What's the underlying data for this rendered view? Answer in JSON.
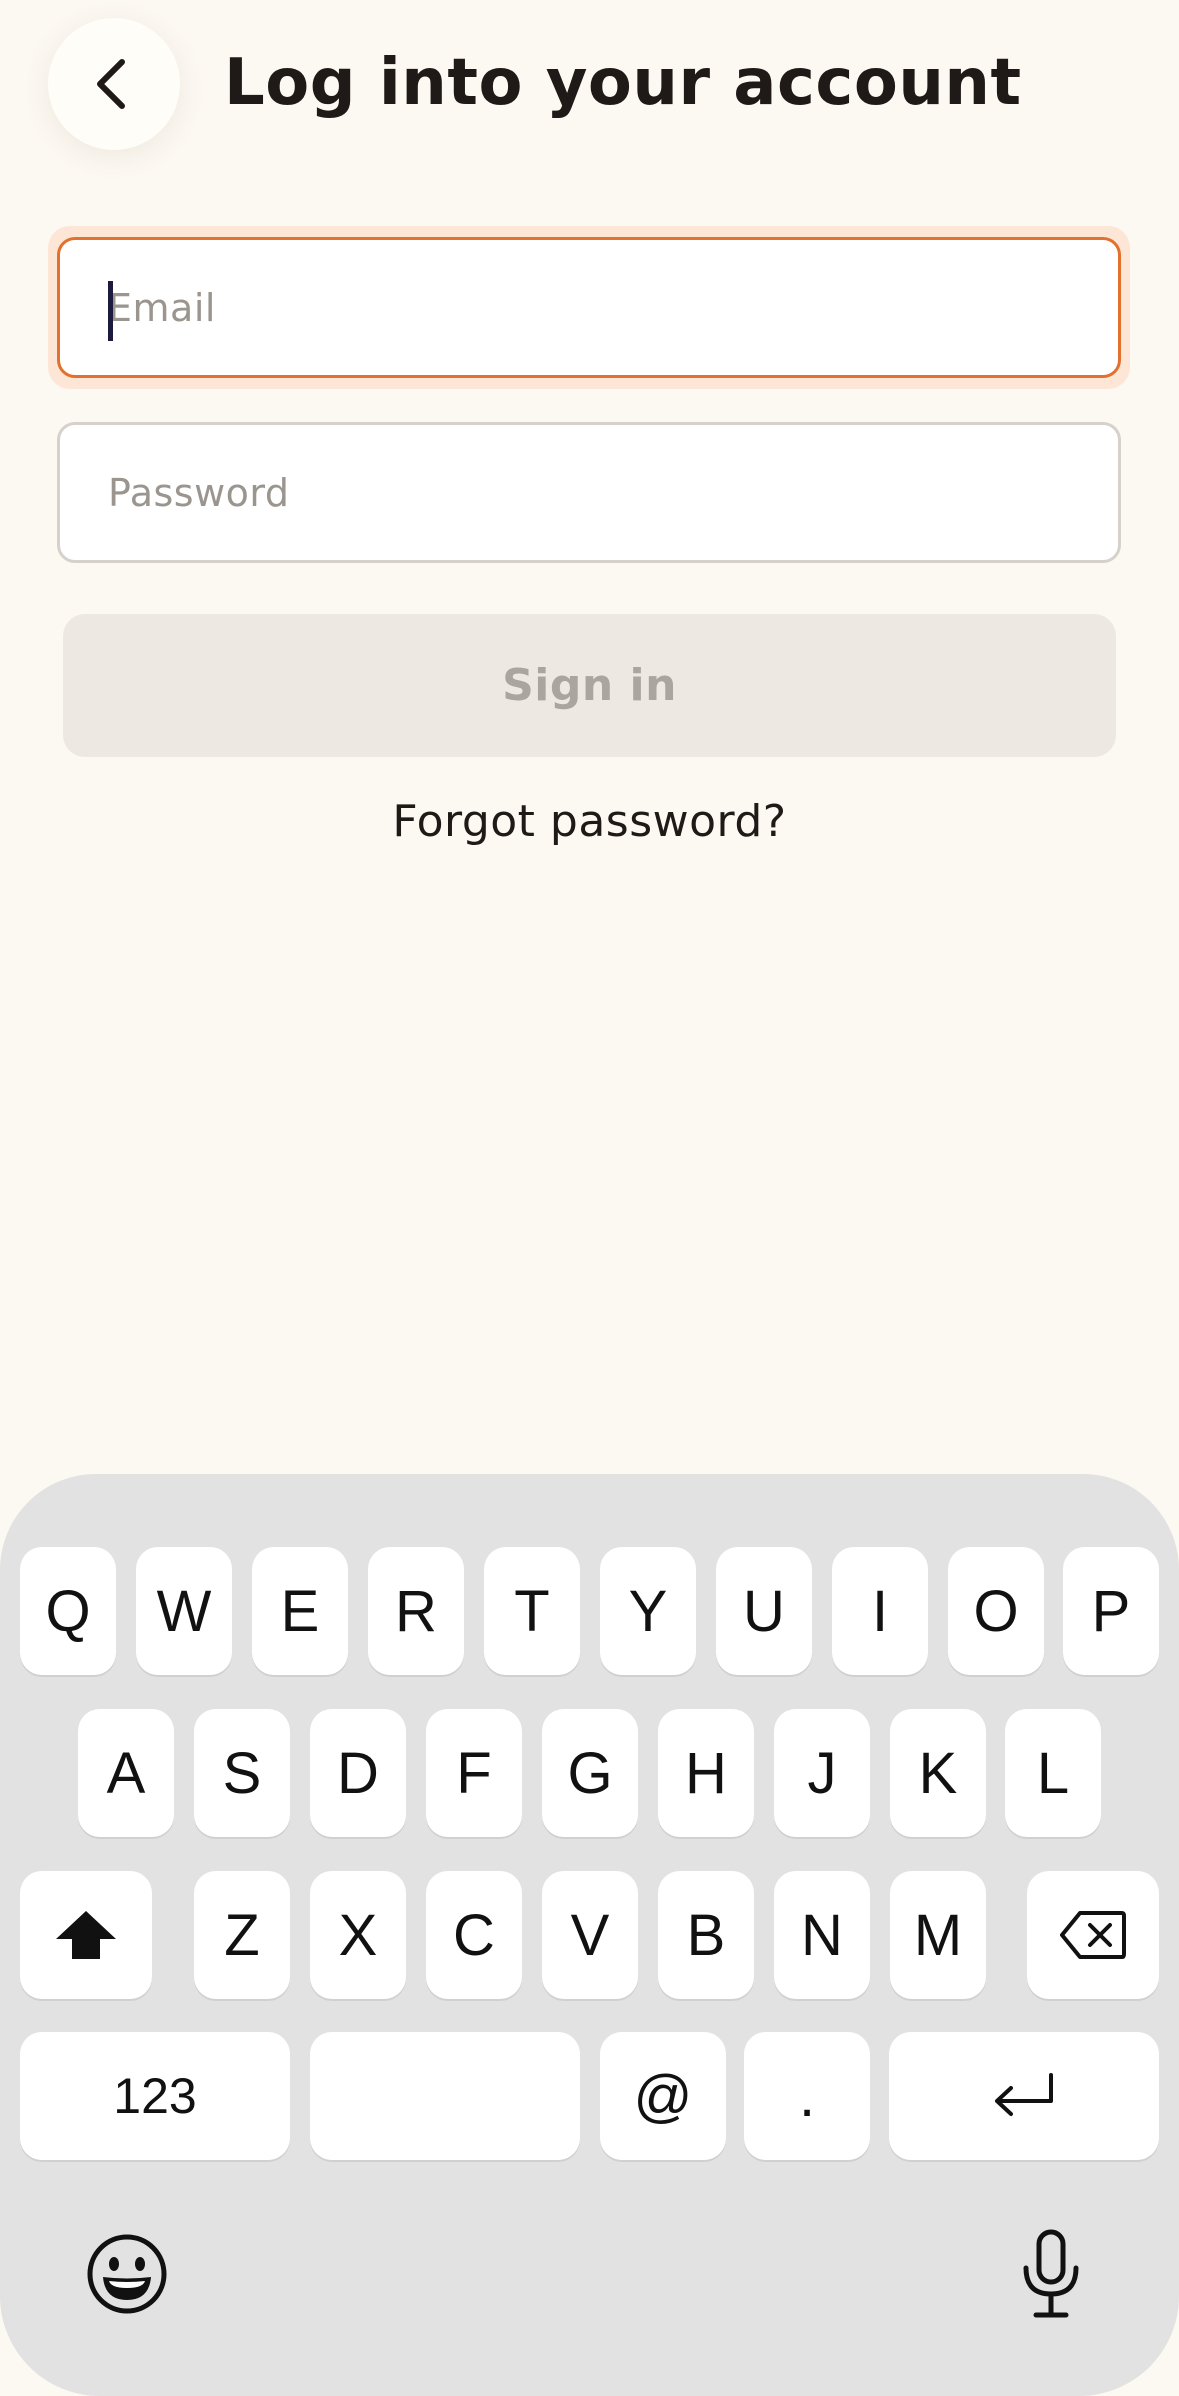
{
  "header": {
    "title": "Log into your account",
    "back_icon": "chevron-left-icon"
  },
  "form": {
    "email_placeholder": "Email",
    "password_placeholder": "Password",
    "signin_label": "Sign in",
    "forgot_label": "Forgot password?"
  },
  "colors": {
    "accent": "#e1712d",
    "background": "#fcf8f2",
    "disabled_button": "#ede9e2"
  },
  "keyboard": {
    "row1": [
      "Q",
      "W",
      "E",
      "R",
      "T",
      "Y",
      "U",
      "I",
      "O",
      "P"
    ],
    "row2": [
      "A",
      "S",
      "D",
      "F",
      "G",
      "H",
      "J",
      "K",
      "L"
    ],
    "row3": [
      "Z",
      "X",
      "C",
      "V",
      "B",
      "N",
      "M"
    ],
    "numbers_label": "123",
    "at_label": "@",
    "period_label": ".",
    "icons": [
      "shift-icon",
      "backspace-icon",
      "return-icon",
      "emoji-icon",
      "microphone-icon"
    ]
  }
}
